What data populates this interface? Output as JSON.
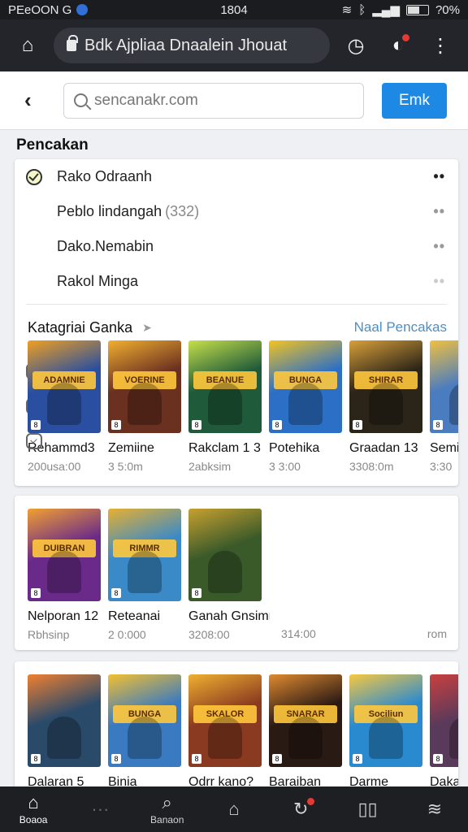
{
  "status": {
    "carrier": "PEeOON G",
    "time": "1804",
    "battery": "?0%"
  },
  "browser": {
    "url": "Bdk Ajpliaa Dnaalein Jhouat"
  },
  "search": {
    "placeholder": "sencanakr.com",
    "button": "Emk"
  },
  "history": {
    "title": "Pencakan",
    "items": [
      {
        "label": "Rako Odraanh",
        "count": ""
      },
      {
        "label": "Peblo lindangah",
        "count": "(332)"
      },
      {
        "label": "Dako.Nemabin",
        "count": ""
      },
      {
        "label": "Rakol Minga",
        "count": ""
      }
    ]
  },
  "categories": {
    "title": "Katagriai Ganka",
    "more": "Naal Pencakas",
    "row1": [
      {
        "name": "Rehammd3",
        "meta": "200usa:00",
        "art": "ADAMNIE",
        "color": "#2a4fa0",
        "accent": "#f0a020"
      },
      {
        "name": "Zemiine",
        "meta": "3 5:0m",
        "art": "VOERINE",
        "color": "#6a3020",
        "accent": "#f2b030"
      },
      {
        "name": "Rakclam 1 3",
        "meta": "2abksim",
        "art": "BEANUE",
        "color": "#1f5a3a",
        "accent": "#c7e04a"
      },
      {
        "name": "Potehika",
        "meta": "3 3:00",
        "art": "BUNGA",
        "color": "#2c6fc7",
        "accent": "#f4c420"
      },
      {
        "name": "Graadan 13",
        "meta": "3308:0m",
        "art": "SHIRAR",
        "color": "#2b2418",
        "accent": "#d9a03a"
      },
      {
        "name": "Semihm",
        "meta": "3:30",
        "art": "",
        "color": "#4a7cc0",
        "accent": "#f0c040"
      }
    ],
    "row2": [
      {
        "name": "Nelporan 12",
        "meta": "Rbhsinp",
        "art": "DUIBRAN",
        "color": "#6a2a8a",
        "accent": "#f2a030"
      },
      {
        "name": "Reteanai",
        "meta": "2 0:000",
        "art": "RIMMR",
        "color": "#3a8ac8",
        "accent": "#e8b030"
      },
      {
        "name": "Ganah Gnsimnkarinan",
        "meta": "3208:00",
        "art": "",
        "color": "#3a5a2a",
        "accent": "#c8a030"
      }
    ],
    "row2_extra": {
      "meta": "314:00",
      "meta2": "rom"
    },
    "row3": [
      {
        "name": "Dalaran 5",
        "meta": "",
        "art": "",
        "color": "#2a4a6a",
        "accent": "#f08030"
      },
      {
        "name": "Binia",
        "meta": "",
        "art": "BUNGA",
        "color": "#3a7ac0",
        "accent": "#f4c030"
      },
      {
        "name": "Odrr kano?",
        "meta": "",
        "art": "SKALOR",
        "color": "#8a3a20",
        "accent": "#f0b030"
      },
      {
        "name": "Baraiban",
        "meta": "",
        "art": "SNARAR",
        "color": "#2a1a14",
        "accent": "#e08a30"
      },
      {
        "name": "Darme",
        "meta": "",
        "art": "Sociliun",
        "color": "#2a8ad0",
        "accent": "#f8c840"
      },
      {
        "name": "Dakahu",
        "meta": "",
        "art": "",
        "color": "#5a3a5a",
        "accent": "#c84040"
      }
    ]
  },
  "nav": [
    {
      "label": "Boaoa",
      "icon": "home-icon"
    },
    {
      "label": "",
      "icon": "dots-icon"
    },
    {
      "label": "Banaon",
      "icon": "search-icon"
    },
    {
      "label": "",
      "icon": "tag-icon"
    },
    {
      "label": "",
      "icon": "refresh-icon"
    },
    {
      "label": "",
      "icon": "book-icon"
    },
    {
      "label": "",
      "icon": "layers-icon"
    }
  ]
}
